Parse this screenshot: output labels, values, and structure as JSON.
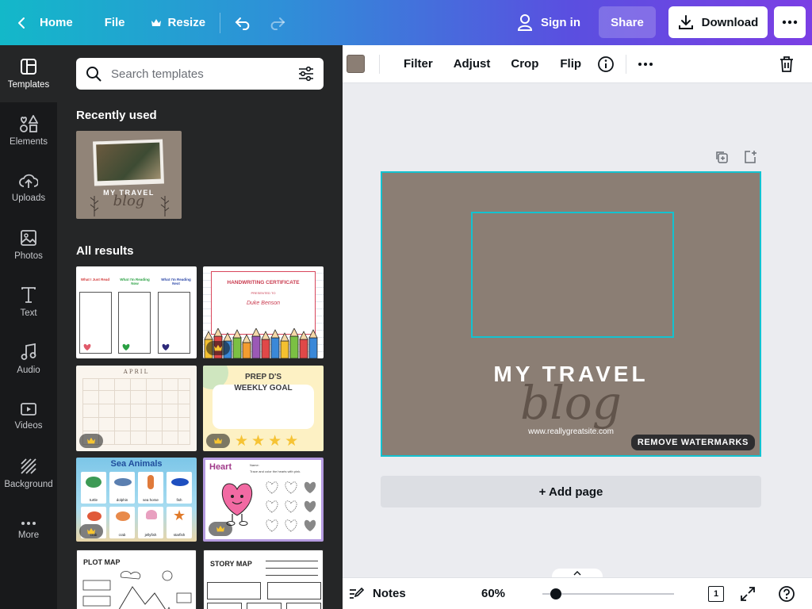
{
  "topbar": {
    "home": "Home",
    "file": "File",
    "resize": "Resize",
    "sign_in": "Sign in",
    "share": "Share",
    "download": "Download"
  },
  "rail": {
    "items": [
      {
        "label": "Templates",
        "icon": "templates-icon"
      },
      {
        "label": "Elements",
        "icon": "elements-icon"
      },
      {
        "label": "Uploads",
        "icon": "uploads-icon"
      },
      {
        "label": "Photos",
        "icon": "photos-icon"
      },
      {
        "label": "Text",
        "icon": "text-icon"
      },
      {
        "label": "Audio",
        "icon": "audio-icon"
      },
      {
        "label": "Videos",
        "icon": "videos-icon"
      },
      {
        "label": "Background",
        "icon": "background-icon"
      },
      {
        "label": "More",
        "icon": "more-icon"
      }
    ]
  },
  "panel": {
    "search_placeholder": "Search templates",
    "recently_used": "Recently used",
    "all_results": "All results",
    "recent_thumb": {
      "title": "MY TRAVEL",
      "script": "blog"
    },
    "templates": [
      {
        "name": "reading-log",
        "headers": [
          "What I Just Read",
          "What I'm Reading Now",
          "What I'm Reading Next"
        ]
      },
      {
        "name": "handwriting-certificate",
        "title": "HANDWRITING CERTIFICATE",
        "presented": "PRESENTED TO",
        "person": "Duke Benson"
      },
      {
        "name": "april-calendar",
        "title": "APRIL"
      },
      {
        "name": "weekly-goal",
        "title": "PREP D'S WEEKLY GOAL"
      },
      {
        "name": "sea-animals",
        "title": "Sea Animals",
        "animals": [
          "turtle",
          "dolphin",
          "sea horse",
          "fish",
          "crab",
          "crab",
          "jellyfish",
          "starfish"
        ]
      },
      {
        "name": "heart-worksheet",
        "title": "Heart",
        "name_label": "Name:",
        "instruction": "Trace and color the hearts with pink."
      },
      {
        "name": "plot-map",
        "title": "PLOT MAP"
      },
      {
        "name": "story-map",
        "title": "STORY MAP"
      }
    ]
  },
  "context_bar": {
    "color": "#8b7e74",
    "filter": "Filter",
    "adjust": "Adjust",
    "crop": "Crop",
    "flip": "Flip"
  },
  "design": {
    "title": "MY TRAVEL",
    "script": "blog",
    "url": "www.reallygreatsite.com",
    "watermark": "REMOVE WATERMARKS",
    "background_color": "#8b7e74"
  },
  "add_page": "+ Add page",
  "bottombar": {
    "notes": "Notes",
    "zoom": "60%",
    "page_count": "1"
  }
}
